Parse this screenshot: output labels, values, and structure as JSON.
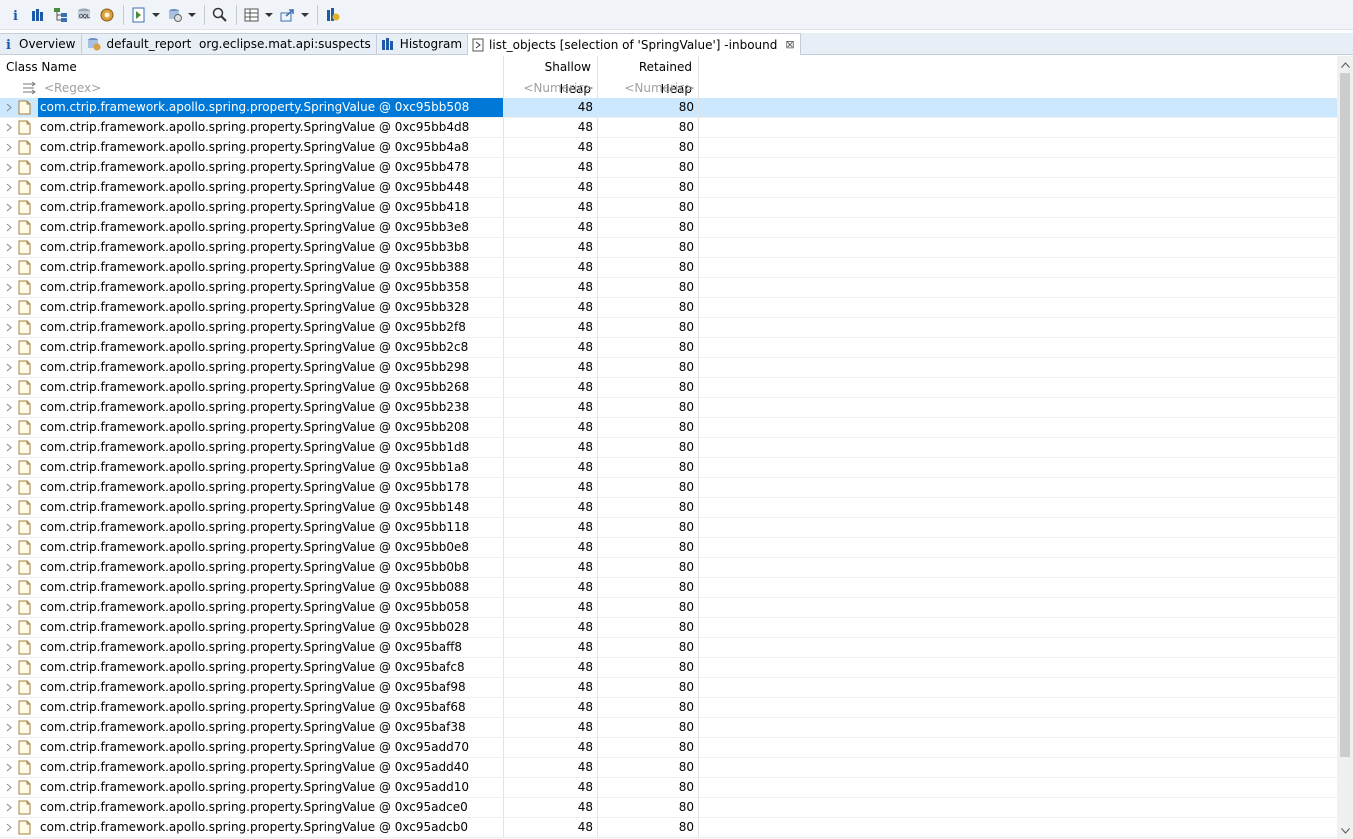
{
  "toolbar": {
    "icons": [
      "info-icon",
      "histogram-icon",
      "dominator-tree-icon",
      "oql-icon",
      "thread-overview-icon",
      "run-report-icon",
      "query-browser-icon",
      "find-object-icon",
      "group-result-icon",
      "export-icon",
      "heap-dump-overview-icon"
    ]
  },
  "tabs": [
    {
      "label": "Overview",
      "icon": "info-icon",
      "active": false
    },
    {
      "label": "default_report  org.eclipse.mat.api:suspects",
      "icon": "report-icon",
      "active": false
    },
    {
      "label": "Histogram",
      "icon": "histogram-icon",
      "active": false
    },
    {
      "label": "list_objects [selection of 'SpringValue'] -inbound",
      "icon": "list-objects-icon",
      "active": true
    }
  ],
  "table": {
    "columns": {
      "class_name": "Class Name",
      "shallow_heap": "Shallow Heap",
      "retained_heap": "Retained Heap"
    },
    "filters": {
      "class_name": "<Regex>",
      "shallow_heap": "<Numeric>",
      "retained_heap": "<Numeric>"
    },
    "rows": [
      {
        "name": "com.ctrip.framework.apollo.spring.property.SpringValue @ 0xc95bb508",
        "shallow": "48",
        "retained": "80",
        "selected": true
      },
      {
        "name": "com.ctrip.framework.apollo.spring.property.SpringValue @ 0xc95bb4d8",
        "shallow": "48",
        "retained": "80"
      },
      {
        "name": "com.ctrip.framework.apollo.spring.property.SpringValue @ 0xc95bb4a8",
        "shallow": "48",
        "retained": "80"
      },
      {
        "name": "com.ctrip.framework.apollo.spring.property.SpringValue @ 0xc95bb478",
        "shallow": "48",
        "retained": "80"
      },
      {
        "name": "com.ctrip.framework.apollo.spring.property.SpringValue @ 0xc95bb448",
        "shallow": "48",
        "retained": "80"
      },
      {
        "name": "com.ctrip.framework.apollo.spring.property.SpringValue @ 0xc95bb418",
        "shallow": "48",
        "retained": "80"
      },
      {
        "name": "com.ctrip.framework.apollo.spring.property.SpringValue @ 0xc95bb3e8",
        "shallow": "48",
        "retained": "80"
      },
      {
        "name": "com.ctrip.framework.apollo.spring.property.SpringValue @ 0xc95bb3b8",
        "shallow": "48",
        "retained": "80"
      },
      {
        "name": "com.ctrip.framework.apollo.spring.property.SpringValue @ 0xc95bb388",
        "shallow": "48",
        "retained": "80"
      },
      {
        "name": "com.ctrip.framework.apollo.spring.property.SpringValue @ 0xc95bb358",
        "shallow": "48",
        "retained": "80"
      },
      {
        "name": "com.ctrip.framework.apollo.spring.property.SpringValue @ 0xc95bb328",
        "shallow": "48",
        "retained": "80"
      },
      {
        "name": "com.ctrip.framework.apollo.spring.property.SpringValue @ 0xc95bb2f8",
        "shallow": "48",
        "retained": "80"
      },
      {
        "name": "com.ctrip.framework.apollo.spring.property.SpringValue @ 0xc95bb2c8",
        "shallow": "48",
        "retained": "80"
      },
      {
        "name": "com.ctrip.framework.apollo.spring.property.SpringValue @ 0xc95bb298",
        "shallow": "48",
        "retained": "80"
      },
      {
        "name": "com.ctrip.framework.apollo.spring.property.SpringValue @ 0xc95bb268",
        "shallow": "48",
        "retained": "80"
      },
      {
        "name": "com.ctrip.framework.apollo.spring.property.SpringValue @ 0xc95bb238",
        "shallow": "48",
        "retained": "80"
      },
      {
        "name": "com.ctrip.framework.apollo.spring.property.SpringValue @ 0xc95bb208",
        "shallow": "48",
        "retained": "80"
      },
      {
        "name": "com.ctrip.framework.apollo.spring.property.SpringValue @ 0xc95bb1d8",
        "shallow": "48",
        "retained": "80"
      },
      {
        "name": "com.ctrip.framework.apollo.spring.property.SpringValue @ 0xc95bb1a8",
        "shallow": "48",
        "retained": "80"
      },
      {
        "name": "com.ctrip.framework.apollo.spring.property.SpringValue @ 0xc95bb178",
        "shallow": "48",
        "retained": "80"
      },
      {
        "name": "com.ctrip.framework.apollo.spring.property.SpringValue @ 0xc95bb148",
        "shallow": "48",
        "retained": "80"
      },
      {
        "name": "com.ctrip.framework.apollo.spring.property.SpringValue @ 0xc95bb118",
        "shallow": "48",
        "retained": "80"
      },
      {
        "name": "com.ctrip.framework.apollo.spring.property.SpringValue @ 0xc95bb0e8",
        "shallow": "48",
        "retained": "80"
      },
      {
        "name": "com.ctrip.framework.apollo.spring.property.SpringValue @ 0xc95bb0b8",
        "shallow": "48",
        "retained": "80"
      },
      {
        "name": "com.ctrip.framework.apollo.spring.property.SpringValue @ 0xc95bb088",
        "shallow": "48",
        "retained": "80"
      },
      {
        "name": "com.ctrip.framework.apollo.spring.property.SpringValue @ 0xc95bb058",
        "shallow": "48",
        "retained": "80"
      },
      {
        "name": "com.ctrip.framework.apollo.spring.property.SpringValue @ 0xc95bb028",
        "shallow": "48",
        "retained": "80"
      },
      {
        "name": "com.ctrip.framework.apollo.spring.property.SpringValue @ 0xc95baff8",
        "shallow": "48",
        "retained": "80"
      },
      {
        "name": "com.ctrip.framework.apollo.spring.property.SpringValue @ 0xc95bafc8",
        "shallow": "48",
        "retained": "80"
      },
      {
        "name": "com.ctrip.framework.apollo.spring.property.SpringValue @ 0xc95baf98",
        "shallow": "48",
        "retained": "80"
      },
      {
        "name": "com.ctrip.framework.apollo.spring.property.SpringValue @ 0xc95baf68",
        "shallow": "48",
        "retained": "80"
      },
      {
        "name": "com.ctrip.framework.apollo.spring.property.SpringValue @ 0xc95baf38",
        "shallow": "48",
        "retained": "80"
      },
      {
        "name": "com.ctrip.framework.apollo.spring.property.SpringValue @ 0xc95add70",
        "shallow": "48",
        "retained": "80"
      },
      {
        "name": "com.ctrip.framework.apollo.spring.property.SpringValue @ 0xc95add40",
        "shallow": "48",
        "retained": "80"
      },
      {
        "name": "com.ctrip.framework.apollo.spring.property.SpringValue @ 0xc95add10",
        "shallow": "48",
        "retained": "80"
      },
      {
        "name": "com.ctrip.framework.apollo.spring.property.SpringValue @ 0xc95adce0",
        "shallow": "48",
        "retained": "80"
      },
      {
        "name": "com.ctrip.framework.apollo.spring.property.SpringValue @ 0xc95adcb0",
        "shallow": "48",
        "retained": "80"
      }
    ]
  },
  "colors": {
    "selection_bg": "#cce8ff",
    "selection_text_bg": "#0078d7",
    "tab_bg": "#e8eef6",
    "toolbar_bg": "#f0f3f8"
  }
}
